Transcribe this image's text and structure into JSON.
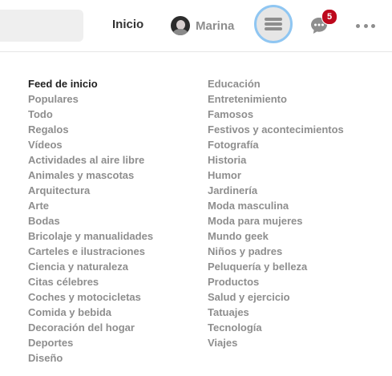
{
  "header": {
    "home_label": "Inicio",
    "profile_name": "Marina",
    "notification_count": "5",
    "accent_color": "#8fc6f2",
    "badge_color": "#bd081c"
  },
  "menu": {
    "left": [
      "Feed de inicio",
      "Populares",
      "Todo",
      "Regalos",
      "Vídeos",
      "Actividades al aire libre",
      "Animales y mascotas",
      "Arquitectura",
      "Arte",
      "Bodas",
      "Bricolaje y manualidades",
      "Carteles e ilustraciones",
      "Ciencia y naturaleza",
      "Citas célebres",
      "Coches y motocicletas",
      "Comida y bebida",
      "Decoración del hogar",
      "Deportes",
      "Diseño"
    ],
    "right": [
      "Educación",
      "Entretenimiento",
      "Famosos",
      "Festivos y acontecimientos",
      "Fotografía",
      "Historia",
      "Humor",
      "Jardinería",
      "Moda masculina",
      "Moda para mujeres",
      "Mundo geek",
      "Niños y padres",
      "Peluquería y belleza",
      "Productos",
      "Salud y ejercicio",
      "Tatuajes",
      "Tecnología",
      "Viajes"
    ]
  }
}
